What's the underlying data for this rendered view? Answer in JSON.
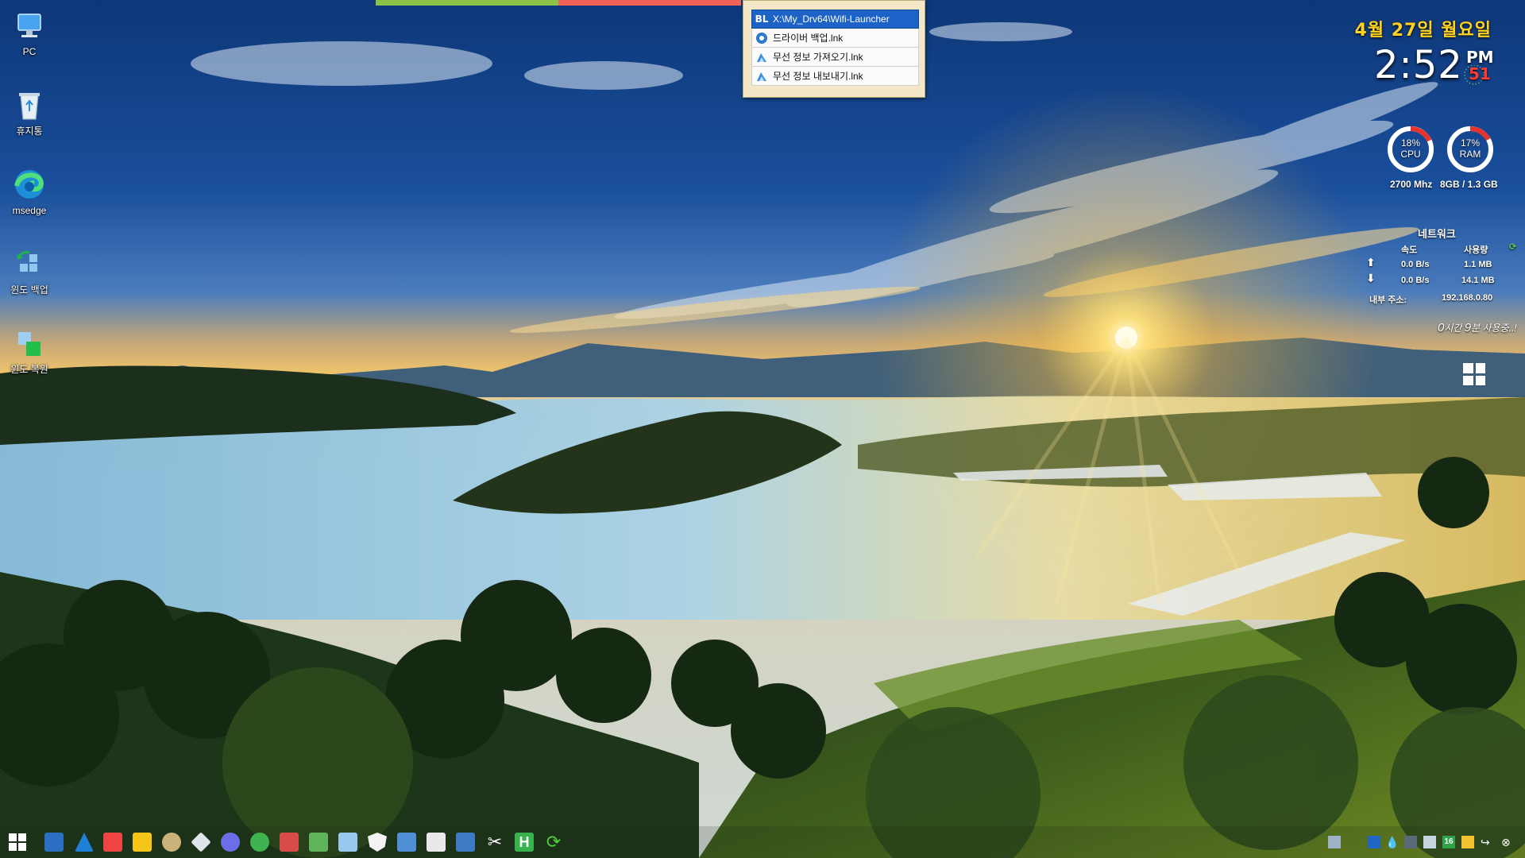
{
  "desktop_icons": [
    {
      "name": "pc-icon",
      "label": "PC"
    },
    {
      "name": "recycle-bin-icon",
      "label": "휴지통"
    },
    {
      "name": "edge-icon",
      "label": "msedge"
    },
    {
      "name": "backup-icon",
      "label": "윈도 백업"
    },
    {
      "name": "restore-icon",
      "label": "윈도 복원"
    }
  ],
  "launcher": {
    "items": [
      {
        "icon": "bl-badge",
        "badge": "BL",
        "label": "X:\\My_Drv64\\Wifi-Launcher",
        "selected": true
      },
      {
        "icon": "gear-icon",
        "label": "드라이버 백업.lnk",
        "selected": false
      },
      {
        "icon": "wifi-import-icon",
        "label": "무선 정보 가져오기.lnk",
        "selected": false
      },
      {
        "icon": "wifi-export-icon",
        "label": "무선 정보 내보내기.lnk",
        "selected": false
      }
    ]
  },
  "clock": {
    "date": "4월 27일 월요일",
    "time": "2:52",
    "ampm": "PM",
    "seconds": "51"
  },
  "system": {
    "cpu": {
      "label": "CPU",
      "percent_text": "18%",
      "value": 0.18,
      "freq": "2700 Mhz"
    },
    "ram": {
      "label": "RAM",
      "percent_text": "17%",
      "value": 0.17,
      "usage": "8GB /  1.3 GB"
    }
  },
  "network": {
    "title": "네트워크",
    "speed_header": "속도",
    "usage_header": "사용량",
    "up_speed": "0.0 B/s",
    "up_usage": "1.1 MB",
    "down_speed": "0.0 B/s",
    "down_usage": "14.1 MB",
    "ip_label": "내부 주소:",
    "ip": "192.168.0.80"
  },
  "uptime": {
    "hours": "0",
    "hours_unit": "시간",
    "minutes": "9",
    "minutes_unit": "분",
    "suffix": "사용중..!"
  },
  "colors": {
    "strip_green": "#8bc34a",
    "strip_red": "#f0625a",
    "date_yellow": "#ffd21f",
    "gauge_red": "#e8332c",
    "launcher_bg": "#f3e7c7",
    "selected_blue": "#1d63c7"
  },
  "taskbar": {
    "start": "windows-start-icon",
    "pinned": [
      "monitor-icon",
      "azure-icon",
      "anydesk-icon",
      "potplayer-icon",
      "cleaner-icon",
      "diamond-icon",
      "chrome-like-icon",
      "globe-icon",
      "network-icon",
      "install-icon",
      "document-icon",
      "shield-icon",
      "remote-icon",
      "image-tool-icon",
      "laptop-icon",
      "scissors-icon",
      "h-app-icon",
      "refresh-icon"
    ],
    "tray": [
      "network-tray-icon",
      "app-tray-icon",
      "drop-icon",
      "storage-icon",
      "display-icon",
      "badge-16-icon",
      "chat-icon",
      "share-icon",
      "close-tray-icon"
    ],
    "tray_badge": "16"
  }
}
